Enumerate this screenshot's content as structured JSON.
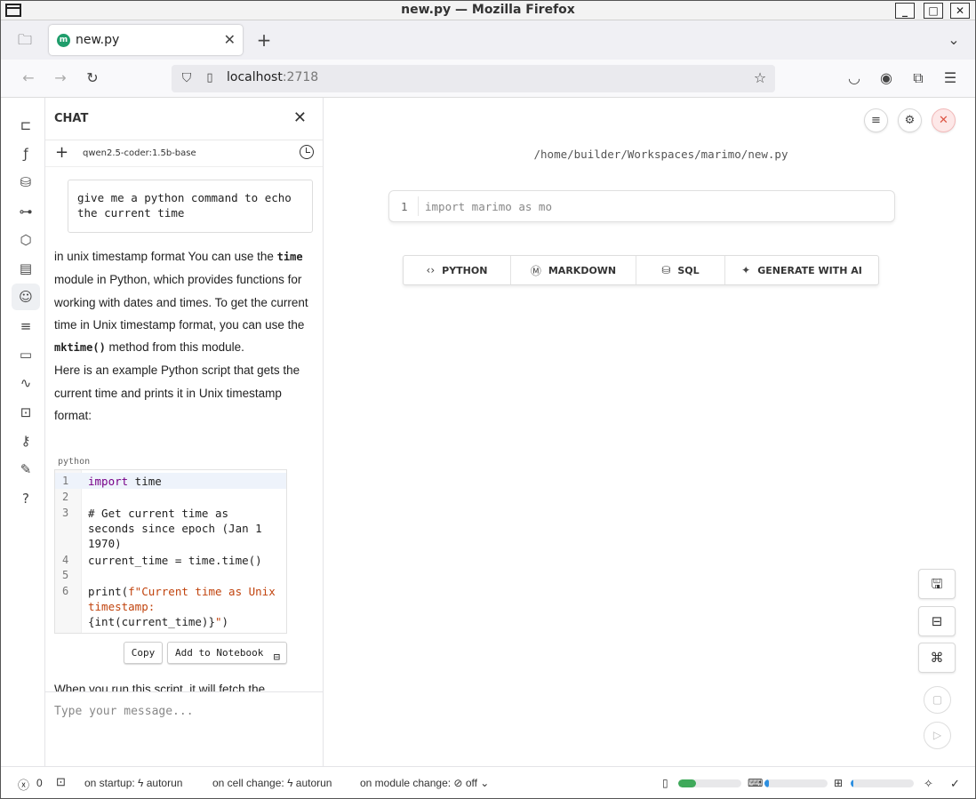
{
  "window": {
    "title": "new.py — Mozilla Firefox"
  },
  "browser": {
    "tab_label": "new.py",
    "tab_favicon": "m",
    "url_host": "localhost",
    "url_port": ":2718"
  },
  "chat": {
    "title": "CHAT",
    "model": "qwen2.5-coder:1.5b-base",
    "user_message": "give me a python command to echo the current time",
    "reply_parts": {
      "p1": "in unix timestamp format You can use the ",
      "code_time": "time",
      "p2": " module in Python, which provides functions for working with dates and times. To get the current time in Unix timestamp format, you can use the ",
      "code_mktime": "mktime()",
      "p3": " method from this module.",
      "p4": "Here is an example Python script that gets the current time and prints it in Unix timestamp format:"
    },
    "code_language": "python",
    "code_lines": {
      "n1": "1",
      "n2": "2",
      "n3": "3",
      "n4": "4",
      "n5": "5",
      "n6": "6",
      "l1_kw": "import",
      "l1_rest": " time",
      "l3": "# Get current time as\nseconds since epoch (Jan 1\n1970)",
      "l4": "current_time = time.time()",
      "l6a": "print(",
      "l6b": "f\"Current time as Unix\ntimestamp:",
      "l6c": "\n{int(current_time)}",
      "l6d": "\"",
      "l6e": ")"
    },
    "copy_label": "Copy",
    "add_label": "Add to Notebook",
    "reply_tail": "When you run this script, it will fetch the",
    "input_placeholder": "Type your message..."
  },
  "main": {
    "file_path": "/home/builder/Workspaces/marimo/new.py",
    "cell_line_number": "1",
    "cell_placeholder": "import marimo as mo",
    "add_buttons": [
      {
        "label": "PYTHON",
        "icon": "code-icon"
      },
      {
        "label": "MARKDOWN",
        "icon": "markdown-icon"
      },
      {
        "label": "SQL",
        "icon": "database-icon"
      },
      {
        "label": "GENERATE WITH AI",
        "icon": "sparkles-icon"
      }
    ]
  },
  "footer": {
    "error_count": "0",
    "startup_label": "on startup:",
    "startup_value": "autorun",
    "cell_change_label": "on cell change:",
    "cell_change_value": "autorun",
    "module_change_label": "on module change:",
    "module_change_value": "off",
    "memory_fraction": 0.28,
    "disk_fraction": 0.07,
    "cpu_fraction": 0.04
  },
  "colors": {
    "accent_green": "#1f9d6b",
    "bar_memory": "#3fa95a",
    "bar_disk": "#2d8fe0",
    "bar_cpu": "#2d8fe0"
  }
}
